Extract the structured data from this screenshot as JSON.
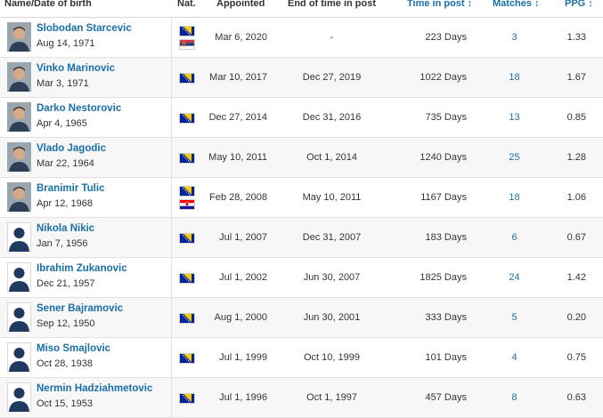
{
  "header": {
    "name_dob": "Name/Date of birth",
    "nat": "Nat.",
    "appointed": "Appointed",
    "end": "End of time in post",
    "time": "Time in post",
    "matches": "Matches",
    "ppg": "PPG",
    "sort_arrow": "↕"
  },
  "colors": {
    "link": "#1a6fa8",
    "bosnia_blue": "#002395",
    "bosnia_yellow": "#fecb00"
  },
  "rows": [
    {
      "name": "Slobodan Starcevic",
      "dob": "Aug 14, 1971",
      "flags": [
        "bosnia",
        "serbia"
      ],
      "photo": "real",
      "appointed": "Mar 6, 2020",
      "end": "-",
      "time": "223 Days",
      "matches": "3",
      "ppg": "1.33"
    },
    {
      "name": "Vinko Marinovic",
      "dob": "Mar 3, 1971",
      "flags": [
        "bosnia"
      ],
      "photo": "real",
      "appointed": "Mar 10, 2017",
      "end": "Dec 27, 2019",
      "time": "1022 Days",
      "matches": "18",
      "ppg": "1.67"
    },
    {
      "name": "Darko Nestorovic",
      "dob": "Apr 4, 1965",
      "flags": [
        "bosnia"
      ],
      "photo": "real",
      "appointed": "Dec 27, 2014",
      "end": "Dec 31, 2016",
      "time": "735 Days",
      "matches": "13",
      "ppg": "0.85"
    },
    {
      "name": "Vlado Jagodic",
      "dob": "Mar 22, 1964",
      "flags": [
        "bosnia"
      ],
      "photo": "real",
      "appointed": "May 10, 2011",
      "end": "Oct 1, 2014",
      "time": "1240 Days",
      "matches": "25",
      "ppg": "1.28"
    },
    {
      "name": "Branimir Tulic",
      "dob": "Apr 12, 1968",
      "flags": [
        "bosnia",
        "croatia"
      ],
      "photo": "real",
      "appointed": "Feb 28, 2008",
      "end": "May 10, 2011",
      "time": "1167 Days",
      "matches": "18",
      "ppg": "1.06"
    },
    {
      "name": "Nikola Nikic",
      "dob": "Jan 7, 1956",
      "flags": [
        "bosnia"
      ],
      "photo": "placeholder",
      "appointed": "Jul 1, 2007",
      "end": "Dec 31, 2007",
      "time": "183 Days",
      "matches": "6",
      "ppg": "0.67"
    },
    {
      "name": "Ibrahim Zukanovic",
      "dob": "Dec 21, 1957",
      "flags": [
        "bosnia"
      ],
      "photo": "placeholder",
      "appointed": "Jul 1, 2002",
      "end": "Jun 30, 2007",
      "time": "1825 Days",
      "matches": "24",
      "ppg": "1.42"
    },
    {
      "name": "Sener Bajramovic",
      "dob": "Sep 12, 1950",
      "flags": [
        "bosnia"
      ],
      "photo": "placeholder",
      "appointed": "Aug 1, 2000",
      "end": "Jun 30, 2001",
      "time": "333 Days",
      "matches": "5",
      "ppg": "0.20"
    },
    {
      "name": "Miso Smajlovic",
      "dob": "Oct 28, 1938",
      "flags": [
        "bosnia"
      ],
      "photo": "placeholder",
      "appointed": "Jul 1, 1999",
      "end": "Oct 10, 1999",
      "time": "101 Days",
      "matches": "4",
      "ppg": "0.75"
    },
    {
      "name": "Nermin Hadziahmetovic",
      "dob": "Oct 15, 1953",
      "flags": [
        "bosnia"
      ],
      "photo": "placeholder",
      "appointed": "Jul 1, 1996",
      "end": "Oct 1, 1997",
      "time": "457 Days",
      "matches": "8",
      "ppg": "0.63"
    }
  ]
}
